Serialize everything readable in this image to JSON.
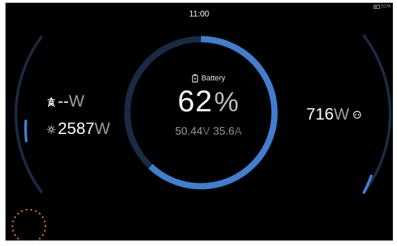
{
  "status_bar": {
    "time": "11:00",
    "battery_percent": "51%"
  },
  "battery": {
    "label": "Battery",
    "soc_value": "62",
    "soc_unit": "%",
    "soc_fraction": 0.62,
    "voltage_value": "50.44",
    "voltage_unit": "V",
    "current_value": "35.6",
    "current_unit": "A"
  },
  "grid": {
    "value": "--",
    "unit": "W",
    "icon": "power-pylon-icon"
  },
  "solar": {
    "value": "2587",
    "unit": "W",
    "icon": "sun-icon"
  },
  "load": {
    "value": "716",
    "unit": "W",
    "icon": "ac-outlet-icon"
  },
  "colors": {
    "accent": "#3f7fd0",
    "track": "#1b2a44",
    "loading_dots": "#e8742c"
  },
  "icons": {
    "battery": "battery-charging-icon",
    "spinner": "loading-dots-icon"
  }
}
